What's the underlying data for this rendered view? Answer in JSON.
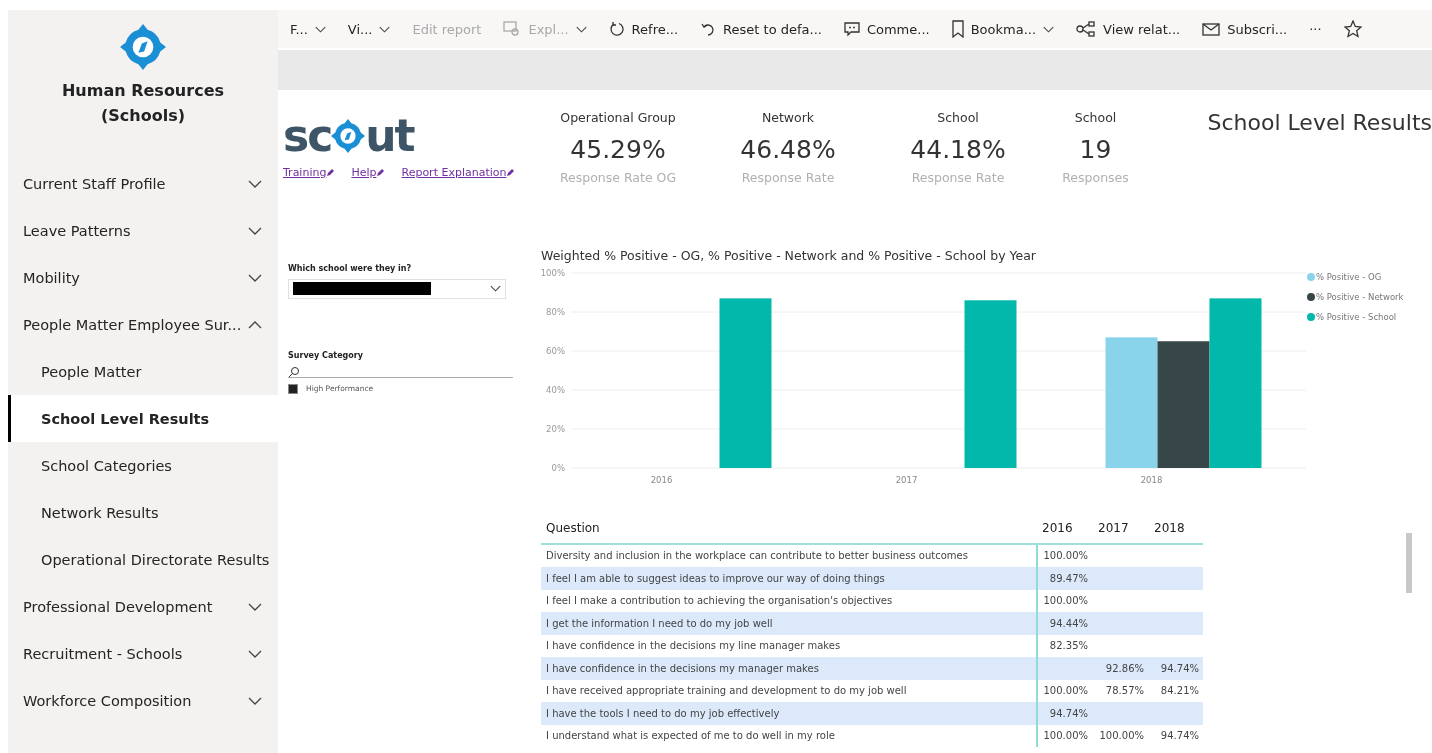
{
  "sidebar": {
    "title": "Human Resources (Schools)",
    "items": [
      {
        "label": "Current Staff Profile",
        "expanded": false
      },
      {
        "label": "Leave Patterns",
        "expanded": false
      },
      {
        "label": "Mobility",
        "expanded": false
      },
      {
        "label": "People Matter Employee Sur...",
        "expanded": true,
        "children": [
          {
            "label": "People Matter",
            "selected": false
          },
          {
            "label": "School Level Results",
            "selected": true
          },
          {
            "label": "School Categories",
            "selected": false
          },
          {
            "label": "Network Results",
            "selected": false
          },
          {
            "label": "Operational Directorate Results",
            "selected": false
          }
        ]
      },
      {
        "label": "Professional Development",
        "expanded": false
      },
      {
        "label": "Recruitment - Schools",
        "expanded": false
      },
      {
        "label": "Workforce Composition",
        "expanded": false
      }
    ]
  },
  "toolbar": [
    {
      "label": "F...",
      "kind": "text",
      "dropdown": true,
      "disabled": false
    },
    {
      "label": "Vi...",
      "kind": "text",
      "dropdown": true,
      "disabled": false
    },
    {
      "label": "Edit report",
      "kind": "text",
      "dropdown": false,
      "disabled": true
    },
    {
      "label": "Expl...",
      "kind": "explore",
      "dropdown": true,
      "disabled": true
    },
    {
      "label": "Refre...",
      "kind": "refresh",
      "dropdown": false,
      "disabled": false
    },
    {
      "label": "Reset to defa...",
      "kind": "reset",
      "dropdown": false,
      "disabled": false
    },
    {
      "label": "Comme...",
      "kind": "comment",
      "dropdown": false,
      "disabled": false
    },
    {
      "label": "Bookma...",
      "kind": "bookmark",
      "dropdown": true,
      "disabled": false
    },
    {
      "label": "View relat...",
      "kind": "share",
      "dropdown": false,
      "disabled": false
    },
    {
      "label": "Subscri...",
      "kind": "mail",
      "dropdown": false,
      "disabled": false
    },
    {
      "label": "···",
      "kind": "text",
      "dropdown": false,
      "disabled": false
    },
    {
      "kind": "star",
      "dropdown": false,
      "disabled": false
    }
  ],
  "logo": {
    "before": "sc",
    "after": "ut"
  },
  "links": [
    "Training",
    "Help",
    "Report Explanation"
  ],
  "kpis": [
    {
      "heading": "Operational Group",
      "value": "45.29%",
      "caption": "Response Rate OG"
    },
    {
      "heading": "Network",
      "value": "46.48%",
      "caption": "Response Rate"
    },
    {
      "heading": "School",
      "value": "44.18%",
      "caption": "Response Rate"
    },
    {
      "heading": "School",
      "value": "19",
      "caption": "Responses"
    }
  ],
  "page_title": "School Level Results",
  "school_filter": {
    "label": "Which school were they in?",
    "redacted": true
  },
  "survey_category": {
    "label": "Survey Category",
    "items": [
      {
        "label": "High Performance",
        "checked": true
      }
    ]
  },
  "chart": {
    "chart_data": {
      "type": "bar",
      "title": "Weighted % Positive - OG, % Positive - Network and % Positive - School by Year",
      "categories": [
        "2016",
        "2017",
        "2018"
      ],
      "series": [
        {
          "name": "% Positive - OG",
          "color": "#8ad4eb",
          "values": [
            null,
            null,
            67
          ]
        },
        {
          "name": "% Positive - Network",
          "color": "#374649",
          "values": [
            null,
            null,
            65
          ]
        },
        {
          "name": "% Positive - School",
          "color": "#01b8aa",
          "values": [
            87,
            86,
            87
          ]
        }
      ],
      "grid": true,
      "legend": true,
      "ylim": [
        0,
        100
      ],
      "yticks": [
        {
          "value": 0,
          "label": "0%"
        },
        {
          "value": 20,
          "label": "20%"
        },
        {
          "value": 40,
          "label": "40%"
        },
        {
          "value": 60,
          "label": "60%"
        },
        {
          "value": 80,
          "label": "80%"
        },
        {
          "value": 100,
          "label": "100%"
        }
      ]
    }
  },
  "table": {
    "columns": [
      "Question",
      "2016",
      "2017",
      "2018"
    ],
    "rows": [
      [
        "Diversity and inclusion in the workplace can contribute to better business outcomes",
        "100.00%",
        null,
        null
      ],
      [
        "I feel I am able to suggest ideas to improve our way of doing things",
        "89.47%",
        null,
        null
      ],
      [
        "I feel I make a contribution to achieving the organisation's objectives",
        "100.00%",
        null,
        null
      ],
      [
        "I get the information I need to do my job well",
        "94.44%",
        null,
        null
      ],
      [
        "I have confidence in the decisions my line manager makes",
        "82.35%",
        null,
        null
      ],
      [
        "I have confidence in the decisions my manager makes",
        null,
        "92.86%",
        "94.74%"
      ],
      [
        "I have received appropriate training and development to do my job well",
        "100.00%",
        "78.57%",
        "84.21%"
      ],
      [
        "I have the tools I need to do my job effectively",
        "94.74%",
        null,
        null
      ],
      [
        "I understand what is expected of me to do well in my role",
        "100.00%",
        "100.00%",
        "94.74%"
      ]
    ]
  }
}
